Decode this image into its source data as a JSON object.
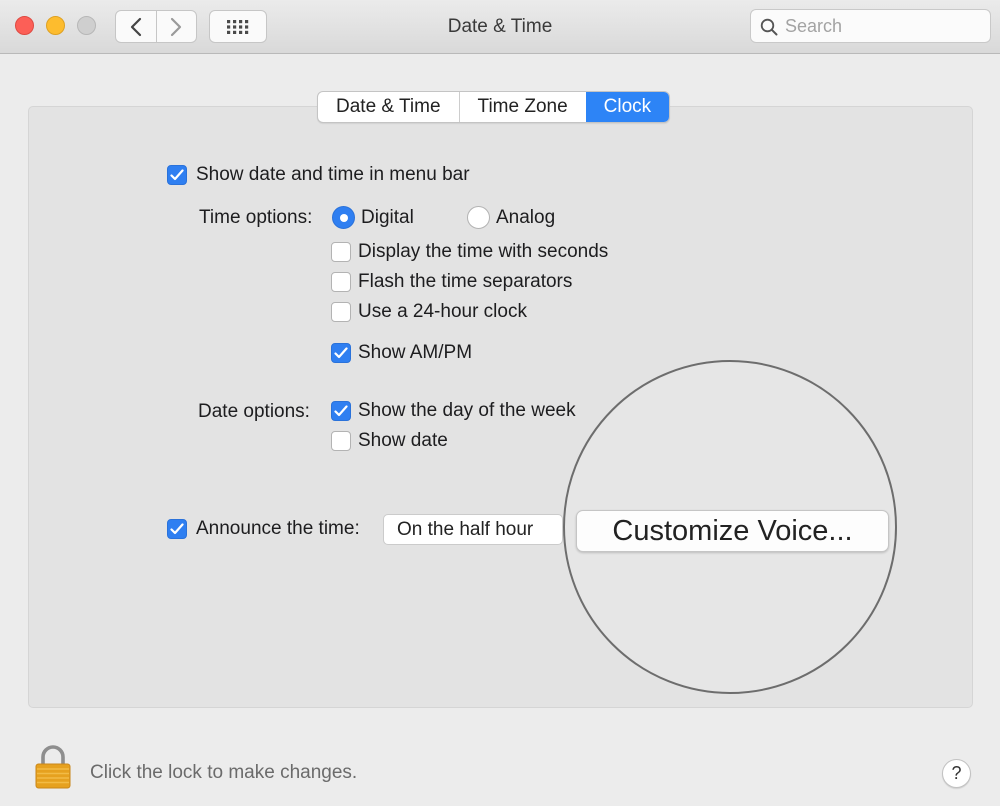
{
  "window": {
    "title": "Date & Time",
    "search_placeholder": "Search"
  },
  "tabs": [
    {
      "label": "Date & Time",
      "active": false
    },
    {
      "label": "Time Zone",
      "active": false
    },
    {
      "label": "Clock",
      "active": true
    }
  ],
  "clock": {
    "show_in_menu_bar": {
      "label": "Show date and time in menu bar",
      "checked": true
    },
    "time_options_label": "Time options:",
    "time_style": [
      {
        "label": "Digital",
        "selected": true
      },
      {
        "label": "Analog",
        "selected": false
      }
    ],
    "time_checkboxes": [
      {
        "label": "Display the time with seconds",
        "checked": false
      },
      {
        "label": "Flash the time separators",
        "checked": false
      },
      {
        "label": "Use a 24-hour clock",
        "checked": false
      },
      {
        "label": "Show AM/PM",
        "checked": true
      }
    ],
    "date_options_label": "Date options:",
    "date_checkboxes": [
      {
        "label": "Show the day of the week",
        "checked": true
      },
      {
        "label": "Show date",
        "checked": false
      }
    ],
    "announce": {
      "label": "Announce the time:",
      "checked": true,
      "interval": "On the half hour"
    },
    "customize_voice_label": "Customize Voice..."
  },
  "footer": {
    "lock_text": "Click the lock to make changes.",
    "help_label": "?"
  },
  "colors": {
    "accent": "#2f7ff1",
    "close": "#fc5f57",
    "minimize": "#fdbc2e",
    "zoom_disabled": "#cfcfcf",
    "lock": "#e6a11f"
  },
  "icons": [
    "back-chevron-icon",
    "forward-chevron-icon",
    "grid-icon",
    "search-icon",
    "checkmark-icon",
    "lock-icon",
    "help-icon"
  ]
}
